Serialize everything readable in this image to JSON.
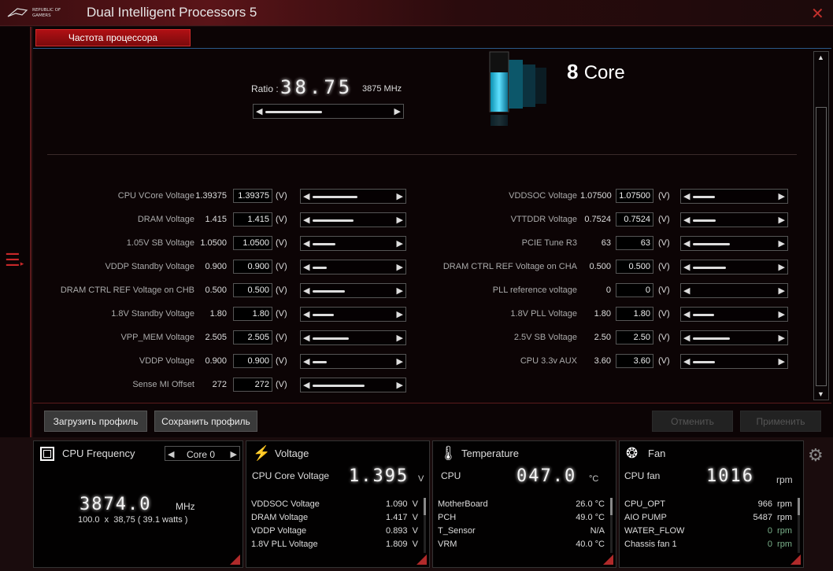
{
  "app": {
    "title": "Dual Intelligent Processors 5",
    "logo_text": "REPUBLIC OF GAMERS"
  },
  "tab": {
    "label": "Частота процессора"
  },
  "ratio": {
    "label": "Ratio :",
    "value": "38.75",
    "mhz": "3875 MHz",
    "slider_fraction": 0.45
  },
  "cores": {
    "count": "8",
    "label": "Core"
  },
  "left_rows": [
    {
      "label": "CPU VCore Voltage",
      "current": "1.39375",
      "input": "1.39375",
      "unit": "(V)",
      "fill": 0.55
    },
    {
      "label": "DRAM Voltage",
      "current": "1.415",
      "input": "1.415",
      "unit": "(V)",
      "fill": 0.5
    },
    {
      "label": "1.05V SB Voltage",
      "current": "1.0500",
      "input": "1.0500",
      "unit": "(V)",
      "fill": 0.28
    },
    {
      "label": "VDDP Standby Voltage",
      "current": "0.900",
      "input": "0.900",
      "unit": "(V)",
      "fill": 0.17
    },
    {
      "label": "DRAM CTRL REF Voltage on CHB",
      "current": "0.500",
      "input": "0.500",
      "unit": "(V)",
      "fill": 0.4
    },
    {
      "label": "1.8V Standby Voltage",
      "current": "1.80",
      "input": "1.80",
      "unit": "(V)",
      "fill": 0.26
    },
    {
      "label": "VPP_MEM Voltage",
      "current": "2.505",
      "input": "2.505",
      "unit": "(V)",
      "fill": 0.45
    },
    {
      "label": "VDDP Voltage",
      "current": "0.900",
      "input": "0.900",
      "unit": "(V)",
      "fill": 0.17
    },
    {
      "label": "Sense MI Offset",
      "current": "272",
      "input": "272",
      "unit": "(V)",
      "fill": 0.64
    }
  ],
  "right_rows": [
    {
      "label": "VDDSOC Voltage",
      "current": "1.07500",
      "input": "1.07500",
      "unit": "(V)",
      "fill": 0.27
    },
    {
      "label": "VTTDDR Voltage",
      "current": "0.7524",
      "input": "0.7524",
      "unit": "(V)",
      "fill": 0.28
    },
    {
      "label": "PCIE Tune R3",
      "current": "63",
      "input": "63",
      "unit": "(V)",
      "fill": 0.45
    },
    {
      "label": "DRAM CTRL REF Voltage on CHA",
      "current": "0.500",
      "input": "0.500",
      "unit": "(V)",
      "fill": 0.4
    },
    {
      "label": "PLL reference voltage",
      "current": "0",
      "input": "0",
      "unit": "(V)",
      "fill": 0
    },
    {
      "label": "1.8V PLL Voltage",
      "current": "1.80",
      "input": "1.80",
      "unit": "(V)",
      "fill": 0.26
    },
    {
      "label": "2.5V SB Voltage",
      "current": "2.50",
      "input": "2.50",
      "unit": "(V)",
      "fill": 0.45
    },
    {
      "label": "CPU 3.3v AUX",
      "current": "3.60",
      "input": "3.60",
      "unit": "(V)",
      "fill": 0.27
    }
  ],
  "buttons": {
    "load": "Загрузить профиль",
    "save": "Сохранить профиль",
    "cancel": "Отменить",
    "apply": "Применить"
  },
  "cpu_freq": {
    "title": "CPU Frequency",
    "core_select": "Core 0",
    "value": "3874.0",
    "unit": "MHz",
    "detail": "100.0  x  38,75 ( 39.1 watts )"
  },
  "voltage": {
    "title": "Voltage",
    "main_label": "CPU Core Voltage",
    "main_value": "1.395",
    "main_unit": "V",
    "items": [
      {
        "name": "VDDSOC Voltage",
        "value": "1.090  V"
      },
      {
        "name": "DRAM Voltage",
        "value": "1.417  V"
      },
      {
        "name": "VDDP Voltage",
        "value": "0.893  V"
      },
      {
        "name": "1.8V PLL Voltage",
        "value": "1.809  V"
      }
    ]
  },
  "temperature": {
    "title": "Temperature",
    "main_label": "CPU",
    "main_value": "047.0",
    "main_unit": "°C",
    "items": [
      {
        "name": "MotherBoard",
        "value": "26.0 °C"
      },
      {
        "name": "PCH",
        "value": "49.0 °C"
      },
      {
        "name": "T_Sensor",
        "value": "N/A"
      },
      {
        "name": "VRM",
        "value": "40.0 °C"
      }
    ]
  },
  "fan": {
    "title": "Fan",
    "main_label": "CPU fan",
    "main_value": "1016",
    "main_unit": "rpm",
    "items": [
      {
        "name": "CPU_OPT",
        "value": "966  rpm"
      },
      {
        "name": "AIO PUMP",
        "value": "5487  rpm"
      },
      {
        "name": "WATER_FLOW",
        "value": "0  rpm"
      },
      {
        "name": "Chassis fan 1",
        "value": "0  rpm"
      }
    ]
  }
}
